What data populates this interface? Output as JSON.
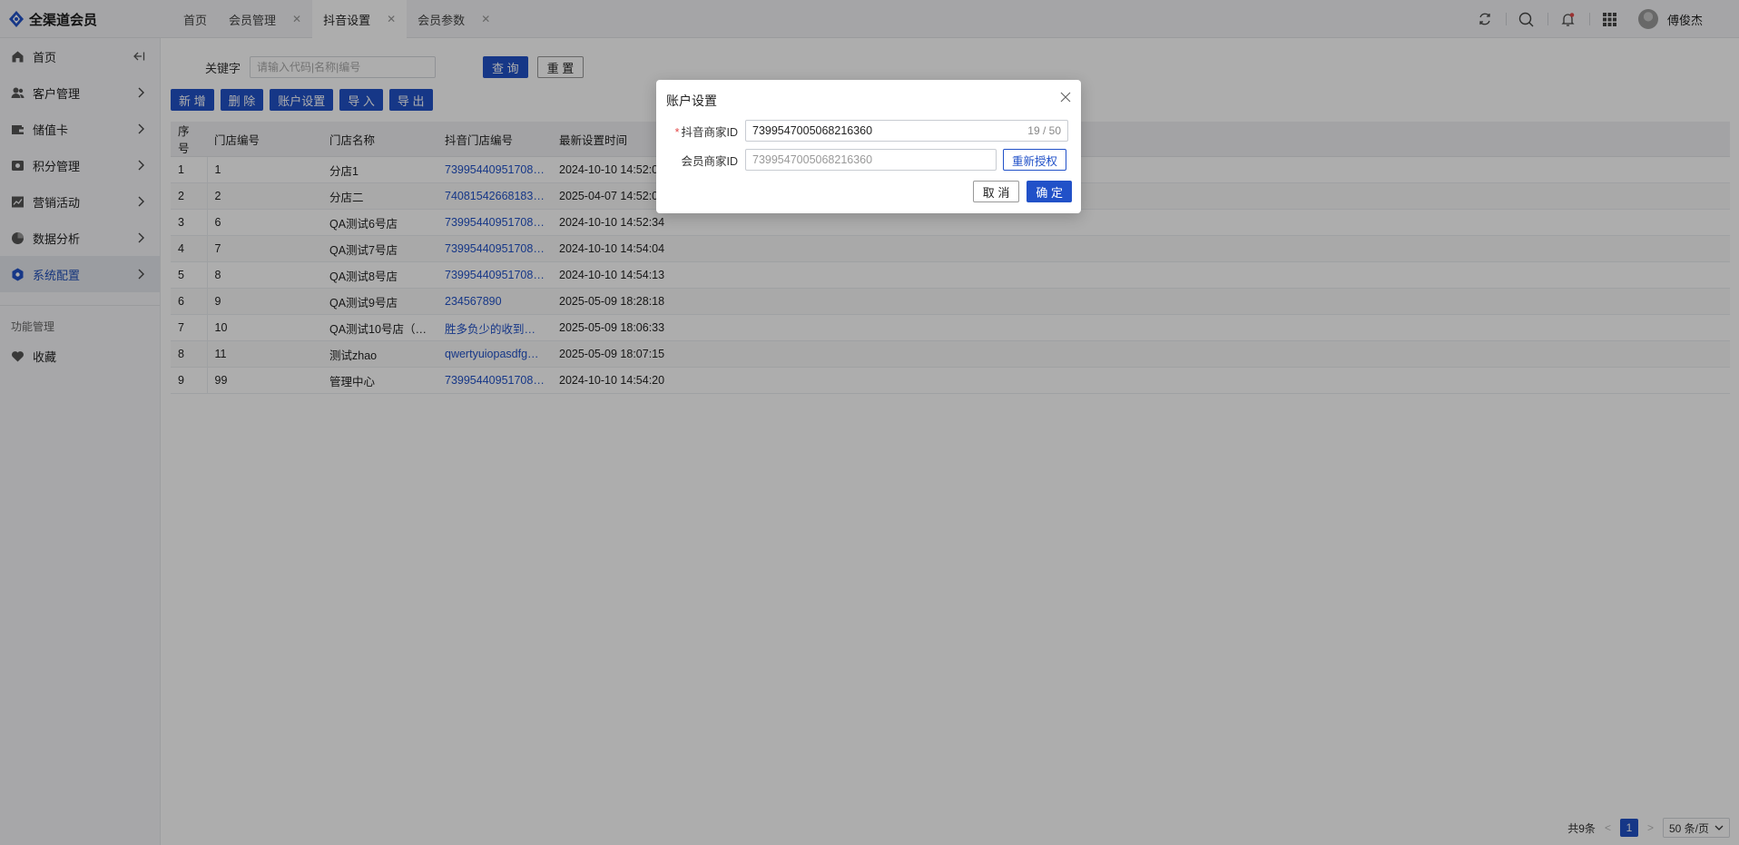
{
  "app": {
    "title": "全渠道会员"
  },
  "tabs": [
    {
      "label": "首页",
      "closable": false
    },
    {
      "label": "会员管理",
      "closable": true
    },
    {
      "label": "抖音设置",
      "closable": true,
      "active": true
    },
    {
      "label": "会员参数",
      "closable": true
    }
  ],
  "header": {
    "user_name": "傅俊杰"
  },
  "sidebar": {
    "items": [
      {
        "label": "首页",
        "icon": "home-icon"
      },
      {
        "label": "客户管理",
        "icon": "users-icon"
      },
      {
        "label": "储值卡",
        "icon": "wallet-icon"
      },
      {
        "label": "积分管理",
        "icon": "points-icon"
      },
      {
        "label": "营销活动",
        "icon": "chart-icon"
      },
      {
        "label": "数据分析",
        "icon": "pie-icon"
      },
      {
        "label": "系统配置",
        "icon": "settings-icon",
        "active": true
      }
    ],
    "section_label": "功能管理",
    "favorites": {
      "label": "收藏",
      "icon": "heart-icon"
    }
  },
  "search": {
    "label": "关键字",
    "placeholder": "请输入代码|名称|编号",
    "query_button": "查 询",
    "reset_button": "重 置"
  },
  "toolbar": {
    "add": "新 增",
    "delete": "删 除",
    "account_settings": "账户设置",
    "import": "导 入",
    "export": "导 出"
  },
  "table": {
    "columns": [
      "序号",
      "门店编号",
      "门店名称",
      "抖音门店编号",
      "最新设置时间"
    ],
    "rows": [
      [
        "1",
        "1",
        "分店1",
        "73995440951708…",
        "2024-10-10 14:52:0"
      ],
      [
        "2",
        "2",
        "分店二",
        "74081542668183…",
        "2025-04-07 14:52:0"
      ],
      [
        "3",
        "6",
        "QA测试6号店",
        "73995440951708…",
        "2024-10-10 14:52:34"
      ],
      [
        "4",
        "7",
        "QA测试7号店",
        "73995440951708…",
        "2024-10-10 14:54:04"
      ],
      [
        "5",
        "8",
        "QA测试8号店",
        "73995440951708…",
        "2024-10-10 14:54:13"
      ],
      [
        "6",
        "9",
        "QA测试9号店",
        "234567890",
        "2025-05-09 18:28:18"
      ],
      [
        "7",
        "10",
        "QA测试10号店（…",
        "胜多负少的收到…",
        "2025-05-09 18:06:33"
      ],
      [
        "8",
        "11",
        "测试zhao",
        "qwertyuiopasdfg…",
        "2025-05-09 18:07:15"
      ],
      [
        "9",
        "99",
        "管理中心",
        "73995440951708…",
        "2024-10-10 14:54:20"
      ]
    ]
  },
  "pagination": {
    "total": "共9条",
    "current_page": "1",
    "page_size": "50 条/页"
  },
  "modal": {
    "title": "账户设置",
    "douyin_label": "抖音商家ID",
    "douyin_value": "7399547005068216360",
    "douyin_count": "19 / 50",
    "member_label": "会员商家ID",
    "member_value": "7399547005068216360",
    "reauth_button": "重新授权",
    "cancel_button": "取 消",
    "confirm_button": "确 定"
  },
  "colors": {
    "primary": "#2151c8",
    "link": "#2151c8",
    "required": "#e34a4a"
  }
}
